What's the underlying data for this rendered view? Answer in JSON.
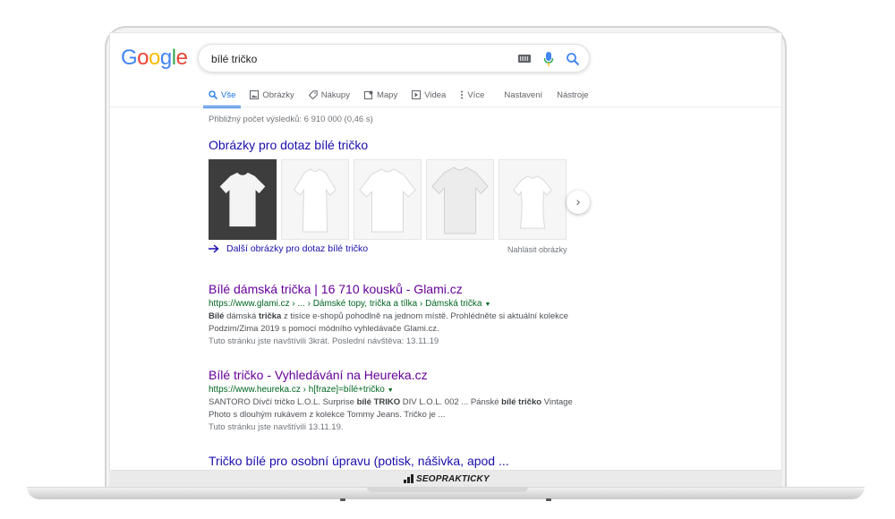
{
  "google": {
    "letters": [
      {
        "ch": "G",
        "color": "#4285F4"
      },
      {
        "ch": "o",
        "color": "#EA4335"
      },
      {
        "ch": "o",
        "color": "#FBBC05"
      },
      {
        "ch": "g",
        "color": "#4285F4"
      },
      {
        "ch": "l",
        "color": "#34A853"
      },
      {
        "ch": "e",
        "color": "#EA4335"
      }
    ]
  },
  "search": {
    "value": "bílé tričko"
  },
  "tabs": {
    "all": "Vše",
    "images": "Obrázky",
    "shopping": "Nákupy",
    "maps": "Mapy",
    "videos": "Videa",
    "more": "Více",
    "settings": "Nastavení",
    "tools": "Nástroje"
  },
  "stats": "Přibližný počet výsledků: 6 910 000 (0,46 s)",
  "images_block": {
    "heading": "Obrázky pro dotaz bílé tričko",
    "more_link": "Další obrázky pro dotaz bílé tričko",
    "report": "Nahlásit obrázky"
  },
  "results": [
    {
      "title": "Bílé dámská trička | 16 710 kousků - Glami.cz",
      "url": "https://www.glami.cz › ... › Dámské topy, trička a tílka › Dámská trička",
      "snippet": [
        {
          "t": "Bílé",
          "b": true
        },
        {
          "t": " dámská ",
          "b": false
        },
        {
          "t": "trička",
          "b": true
        },
        {
          "t": " z tisíce e-shopů pohodlně na jednom místě. Prohlédněte si aktuální kolekce Podzim/Zima 2019 s pomocí módního vyhledávače Glami.cz.",
          "b": false
        }
      ],
      "visited": "Tuto stránku jste navštívili 3krát. Poslední návštěva: 13.11.19"
    },
    {
      "title": "Bílé tričko - Vyhledávání na Heureka.cz",
      "url": "https://www.heureka.cz › h[fraze]=bílé+tričko",
      "snippet": [
        {
          "t": "SANTORO Dívčí tričko L.O.L. Surprise ",
          "b": false
        },
        {
          "t": "bílé TRIKO",
          "b": true
        },
        {
          "t": " DIV L.O.L. 002 ... Pánské ",
          "b": false
        },
        {
          "t": "bílé tričko",
          "b": true
        },
        {
          "t": " Vintage Photo s dlouhým rukávem z kolekce Tommy Jeans. Tričko je ...",
          "b": false
        }
      ],
      "visited": "Tuto stránku jste navštívili 13.11.19."
    },
    {
      "title": "Tričko bílé pro osobní úpravu (potisk, nášivka, apod ..."
    }
  ],
  "laptop": {
    "brand": "SEOPRAKTICKY"
  },
  "colors": {
    "link": "#1a0dab",
    "visited": "#660099",
    "url": "#006621",
    "accent": "#1a73e8"
  }
}
